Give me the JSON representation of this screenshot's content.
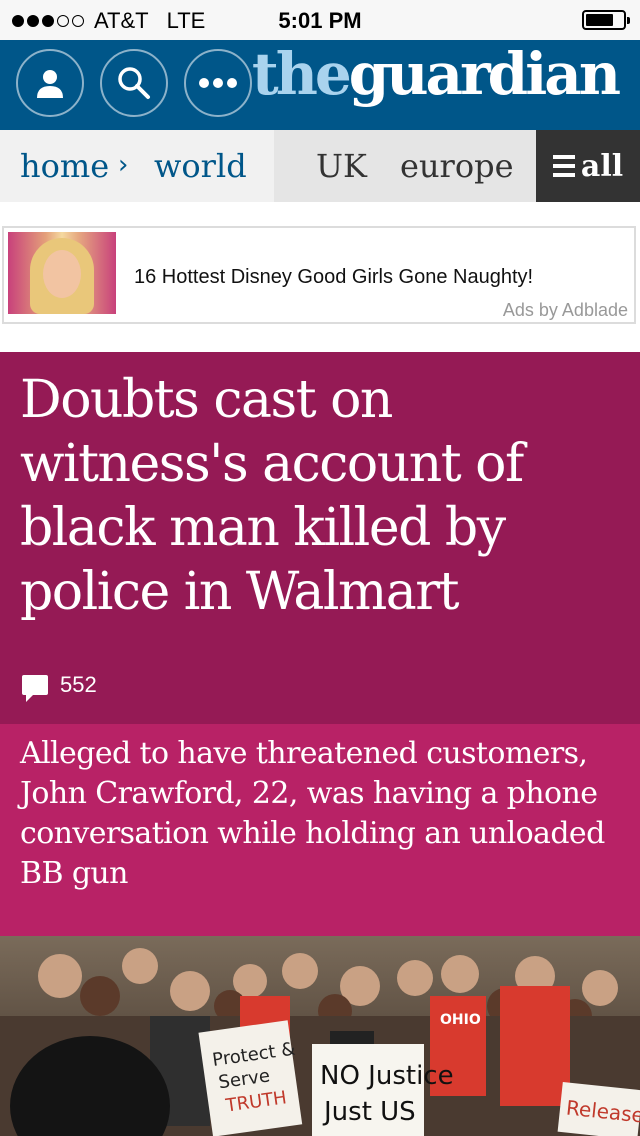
{
  "status_bar": {
    "carrier": "AT&T",
    "network": "LTE",
    "time": "5:01 PM",
    "signal_bars": 3,
    "signal_total": 5,
    "battery_level": 0.75
  },
  "header": {
    "logo_the": "the",
    "logo_guardian": "guardian"
  },
  "toolbar": {
    "profile_icon": "person-icon",
    "search_icon": "search-icon",
    "more_icon": "more-dots-icon"
  },
  "nav": {
    "home": "home",
    "separator": "›",
    "world": "world",
    "uk": "UK",
    "europe": "europe",
    "all": "all"
  },
  "ad": {
    "title": "16 Hottest Disney Good Girls Gone Naughty!",
    "source": "Ads by Adblade"
  },
  "article": {
    "headline": "Doubts cast on witness's account of black man killed by police in Walmart",
    "comment_count": "552",
    "standfirst": "Alleged to have threatened customers, John Crawford, 22, was having a phone conversation while holding an unloaded BB gun"
  },
  "photo": {
    "signs": [
      "Protect & Serve",
      "TRUTH",
      "NO Justice Just US",
      "OHIO",
      "Release the Tape"
    ]
  },
  "colors": {
    "masthead": "#005689",
    "headline_bg": "#951a55",
    "standfirst_bg": "#b82266",
    "nav_all_bg": "#333333"
  }
}
